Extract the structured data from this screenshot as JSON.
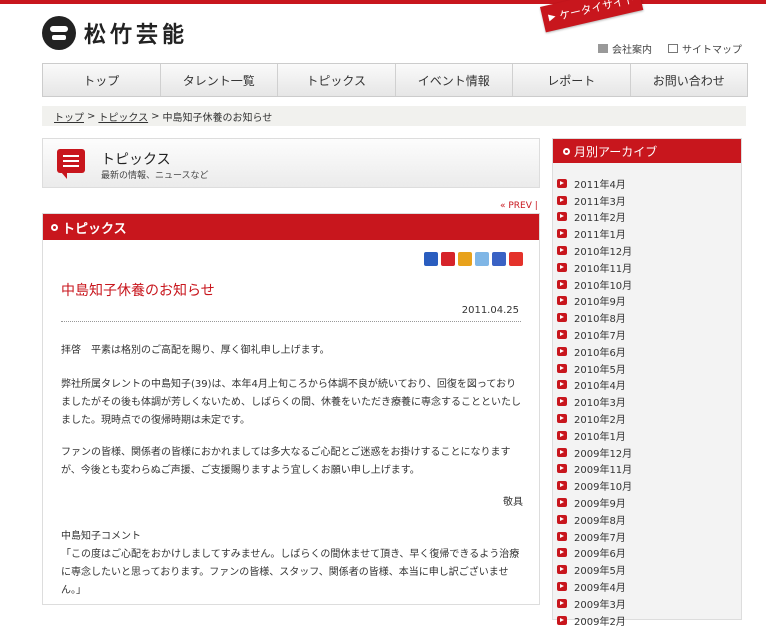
{
  "site": {
    "logo_text": "松竹芸能",
    "mobile_site_label": "ケータイサイト"
  },
  "utility": {
    "company": "会社案内",
    "sitemap": "サイトマップ"
  },
  "nav": [
    "トップ",
    "タレント一覧",
    "トピックス",
    "イベント情報",
    "レポート",
    "お問い合わせ"
  ],
  "breadcrumb": {
    "home": "トップ",
    "sep1": ">",
    "topics": "トピックス",
    "sep2": ">",
    "current": "中島知子休養のお知らせ"
  },
  "section": {
    "title": "トピックス",
    "subtitle": "最新の情報、ニュースなど",
    "prev": "« PREV |"
  },
  "panel": {
    "title": "トピックス"
  },
  "article": {
    "title": "中島知子休養のお知らせ",
    "date": "2011.04.25",
    "p1": "拝啓　平素は格別のご高配を賜り、厚く御礼申し上げます。",
    "p2": "弊社所属タレントの中島知子(39)は、本年4月上旬ころから体調不良が続いており、回復を図っておりましたがその後も体調が芳しくないため、しばらくの間、休養をいただき療養に専念することといたしました。現時点での復帰時期は未定です。",
    "p3": "ファンの皆様、関係者の皆様におかれましては多大なるご心配とご迷惑をお掛けすることになりますが、今後とも変わらぬご声援、ご支援賜りますよう宜しくお願い申し上げます。",
    "closing": "敬具",
    "comment_label": "中島知子コメント",
    "comment": "「この度はご心配をおかけしましてすみません。しばらくの間休ませて頂き、早く復帰できるよう治療に専念したいと思っております。ファンの皆様、スタッフ、関係者の皆様、本当に申し訳ございません。」"
  },
  "sidebar": {
    "title": "月別アーカイブ",
    "months": [
      "2011年4月",
      "2011年3月",
      "2011年2月",
      "2011年1月",
      "2010年12月",
      "2010年11月",
      "2010年10月",
      "2010年9月",
      "2010年8月",
      "2010年7月",
      "2010年6月",
      "2010年5月",
      "2010年4月",
      "2010年3月",
      "2010年2月",
      "2010年1月",
      "2009年12月",
      "2009年11月",
      "2009年10月",
      "2009年9月",
      "2009年8月",
      "2009年7月",
      "2009年6月",
      "2009年5月",
      "2009年4月",
      "2009年3月",
      "2009年2月"
    ]
  },
  "colors": {
    "accent": "#c8161d"
  }
}
